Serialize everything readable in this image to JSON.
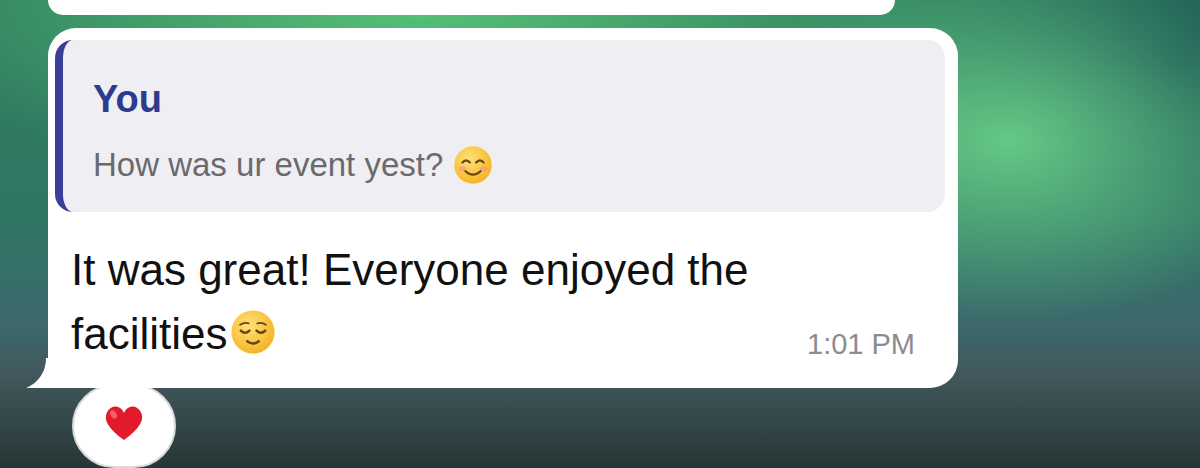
{
  "message": {
    "quote": {
      "author": "You",
      "text": "How was ur event yest?",
      "emoji": "smiling"
    },
    "text": "It was great! Everyone enjoyed the facilities",
    "emoji": "relieved",
    "time": "1:01 PM",
    "reactions": [
      {
        "kind": "heart"
      }
    ]
  }
}
